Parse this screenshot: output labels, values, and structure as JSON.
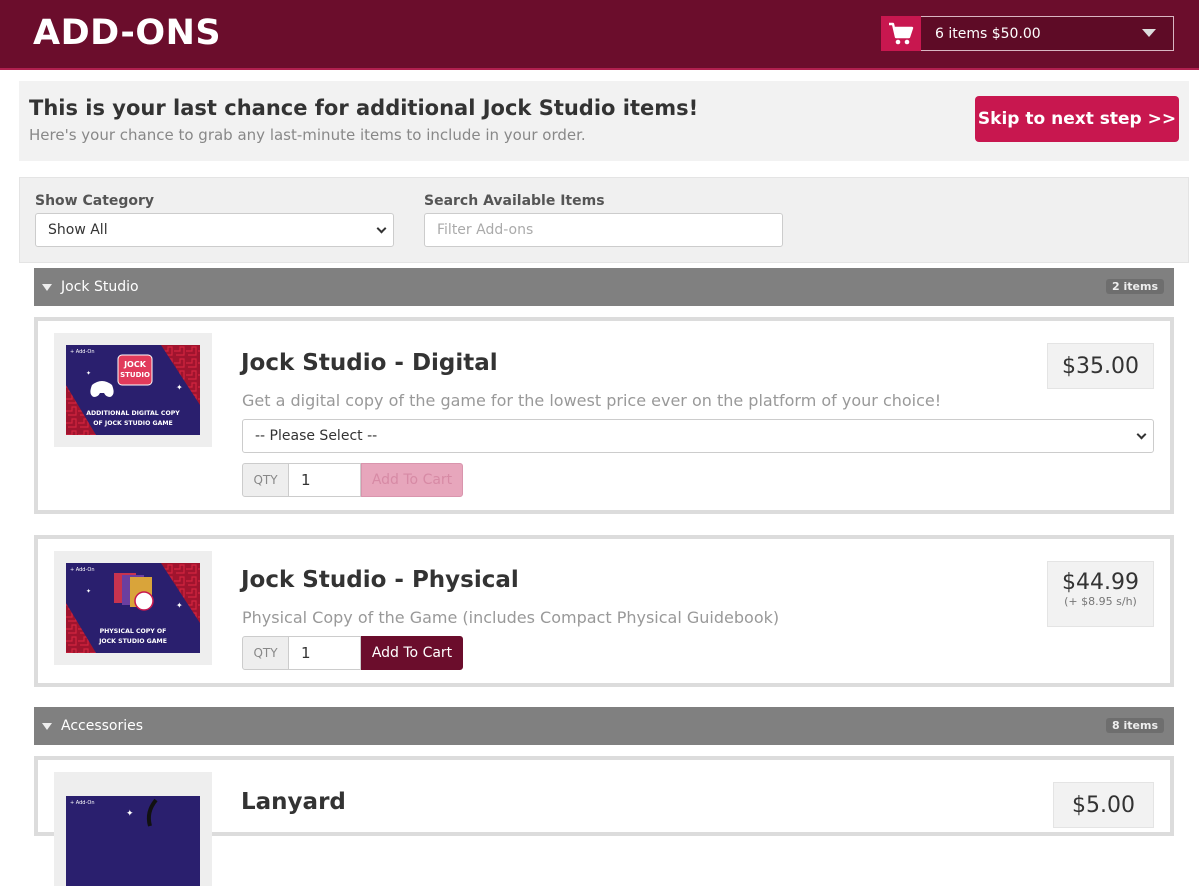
{
  "header": {
    "title": "ADD-ONS",
    "cart_summary": "6 items $50.00",
    "cart_icon": "shopping-cart-icon"
  },
  "intro": {
    "heading": "This is your last chance for additional Jock Studio items!",
    "subtext": "Here's your chance to grab any last-minute items to include in your order.",
    "skip_label": "Skip to next step >>"
  },
  "filters": {
    "category_label": "Show Category",
    "category_value": "Show All",
    "search_label": "Search Available Items",
    "search_placeholder": "Filter Add-ons"
  },
  "categories": [
    {
      "name": "Jock Studio",
      "count": "2 items",
      "products": [
        {
          "title": "Jock Studio - Digital",
          "description": "Get a digital copy of the game for the lowest price ever on the platform of your choice!",
          "price": "$35.00",
          "variant_select": "-- Please Select --",
          "qty_label": "QTY",
          "qty": "1",
          "add_label": "Add To Cart",
          "thumb_tag": "+ Add-On",
          "thumb_logo_line1": "JOCK",
          "thumb_logo_line2": "STUDIO",
          "thumb_caption1": "ADDITIONAL DIGITAL COPY",
          "thumb_caption2": "OF JOCK STUDIO GAME"
        },
        {
          "title": "Jock Studio - Physical",
          "description": "Physical Copy of the Game (includes Compact Physical Guidebook)",
          "price": "$44.99",
          "shipping": "(+ $8.95 s/h)",
          "qty_label": "QTY",
          "qty": "1",
          "add_label": "Add To Cart",
          "thumb_tag": "+ Add-On",
          "thumb_caption1": "PHYSICAL COPY OF",
          "thumb_caption2": "JOCK STUDIO GAME"
        }
      ]
    },
    {
      "name": "Accessories",
      "count": "8 items",
      "products": [
        {
          "title": "Lanyard",
          "price": "$5.00",
          "thumb_tag": "+ Add-On"
        }
      ]
    }
  ],
  "colors": {
    "brand": "#6b0d2c",
    "accent": "#c8174f",
    "category_bar": "#808080"
  }
}
